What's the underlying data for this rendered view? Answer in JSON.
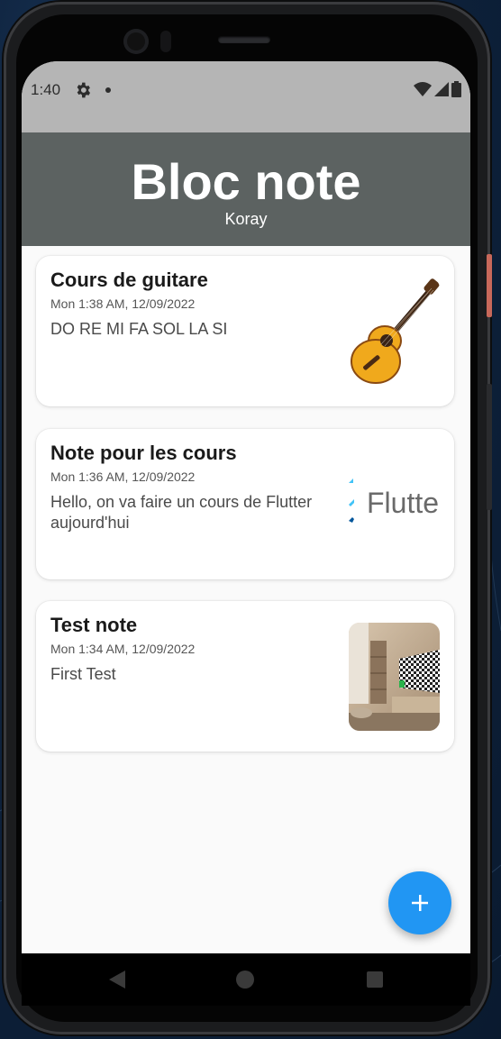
{
  "status_bar": {
    "time": "1:40",
    "icons": [
      "gear-icon",
      "dot-icon",
      "wifi-icon",
      "signal-icon",
      "battery-icon"
    ]
  },
  "app_bar": {
    "title": "Bloc note",
    "subtitle": "Koray",
    "color": "#5c6261"
  },
  "notes": [
    {
      "title": "Cours de guitare",
      "date": "Mon 1:38 AM, 12/09/2022",
      "body": "DO RE MI FA SOL LA SI",
      "thumbnail": "guitar-image"
    },
    {
      "title": "Note pour les cours",
      "date": "Mon 1:36 AM, 12/09/2022",
      "body": "Hello, on va faire un cours de Flutter aujourd'hui",
      "thumbnail": "flutter-logo-image",
      "thumbnail_text": "Flutte"
    },
    {
      "title": "Test note",
      "date": "Mon 1:34 AM, 12/09/2022",
      "body": "First Test",
      "thumbnail": "living-room-image"
    }
  ],
  "fab": {
    "icon": "plus-icon",
    "color": "#2196f3"
  },
  "nav_bar": {
    "icons": [
      "back-icon",
      "home-icon",
      "recent-apps-icon"
    ]
  }
}
